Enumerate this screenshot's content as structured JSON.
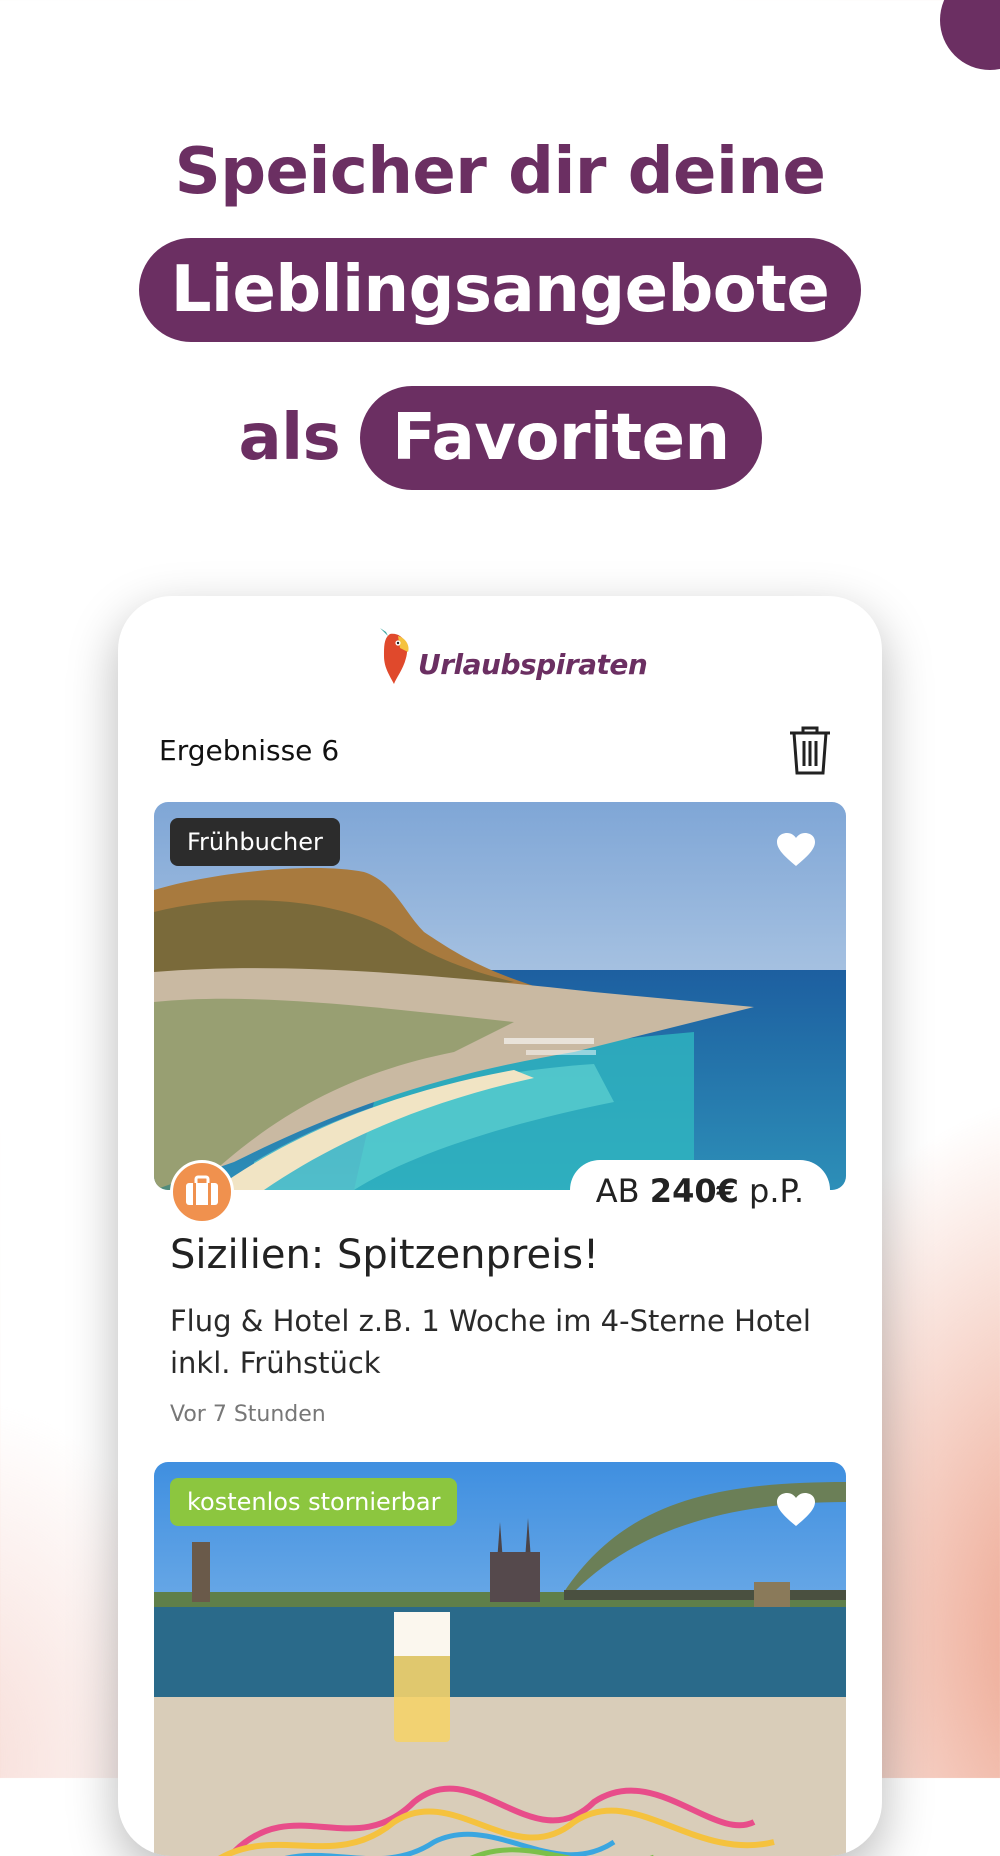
{
  "promo": {
    "line1": "Speicher dir deine",
    "line2_pill": "Lieblingsangebote",
    "line3_plain": "als",
    "line3_pill": "Favoriten"
  },
  "app": {
    "logo_text": "Urlaubspiraten",
    "results_label": "Ergebnisse 6"
  },
  "cards": [
    {
      "badge": "Frühbucher",
      "price_prefix": "AB ",
      "price": "240€",
      "price_suffix": " p.P.",
      "title": "Sizilien: Spitzenpreis!",
      "description": "Flug & Hotel z.B. 1 Woche im 4-Sterne Hotel inkl. Frühstück",
      "time": "Vor 7 Stunden"
    },
    {
      "badge": "kostenlos stornierbar"
    }
  ],
  "colors": {
    "brand": "#6b2f62",
    "badge_dark": "#2c2c2c",
    "badge_green": "#8cc63f",
    "suitcase": "#f0914e"
  },
  "icons": [
    "trash-icon",
    "heart-icon",
    "suitcase-icon",
    "parrot-logo-icon"
  ]
}
